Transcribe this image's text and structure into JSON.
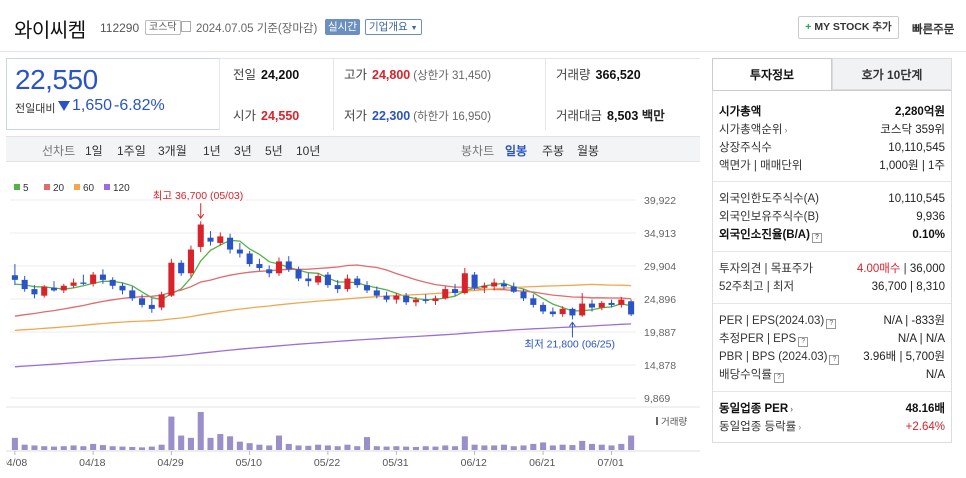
{
  "header": {
    "name": "와이씨켐",
    "code": "112290",
    "market": "코스닥",
    "date_text": "2024.07.05  기준(장마감)",
    "realtime": "실시간",
    "overview": "기업개요",
    "my_stock": "MY STOCK 추가",
    "quick_order": "빠른주문"
  },
  "price": {
    "current": "22,550",
    "change_label": "전일대비",
    "change": "1,650",
    "change_pct": "-6.82%"
  },
  "stats": {
    "prev_close_label": "전일",
    "prev_close": "24,200",
    "high_label": "고가",
    "high": "24,800",
    "upper_limit": "(상한가 31,450)",
    "volume_label": "거래량",
    "volume": "366,520",
    "open_label": "시가",
    "open": "24,550",
    "low_label": "저가",
    "low": "22,300",
    "lower_limit": "(하한가 16,950)",
    "amount_label": "거래대금",
    "amount": "8,503",
    "amount_unit": "백만"
  },
  "period_bar": {
    "line_chart": "선차트",
    "periods": [
      "1일",
      "1주일",
      "3개월",
      "1년",
      "3년",
      "5년",
      "10년"
    ],
    "candle_chart": "봉차트",
    "candles": [
      "일봉",
      "주봉",
      "월봉"
    ],
    "active_candle": "일봉"
  },
  "colors": {
    "up": "#d9232a",
    "down": "#2a54c6",
    "ma5": "#55b24a",
    "ma20": "#e06b6b",
    "ma60": "#f0a850",
    "ma120": "#9b6fd6",
    "volume": "#9b8fc9"
  },
  "chart_data": {
    "type": "candlestick",
    "legend": [
      "5",
      "20",
      "60",
      "120"
    ],
    "y_ticks": [
      "39,922",
      "34,913",
      "29,904",
      "24,896",
      "19,887",
      "14,878",
      "9,869"
    ],
    "ylim": [
      9869,
      39922
    ],
    "x_ticks": [
      "04/08",
      "04/18",
      "04/29",
      "05/10",
      "05/22",
      "05/31",
      "06/12",
      "06/21",
      "07/01"
    ],
    "x_tick_index": [
      0,
      8,
      16,
      24,
      32,
      39,
      47,
      54,
      61
    ],
    "max_label": "최고 36,700 (05/03)",
    "max_index": 19,
    "max_value": 36700,
    "min_label": "최저 21,800 (06/25)",
    "min_index": 57,
    "min_value": 21800,
    "volume_label": "거래량",
    "candles": [
      [
        28500,
        30200,
        27000,
        27800
      ],
      [
        27800,
        28400,
        26000,
        26400
      ],
      [
        26400,
        27000,
        25000,
        25600
      ],
      [
        25400,
        27000,
        25100,
        26800
      ],
      [
        26600,
        27600,
        26000,
        26200
      ],
      [
        26200,
        27200,
        25800,
        26900
      ],
      [
        26900,
        28000,
        26600,
        27400
      ],
      [
        27400,
        28600,
        27000,
        27200
      ],
      [
        27200,
        29000,
        26800,
        28600
      ],
      [
        28600,
        29400,
        27200,
        27800
      ],
      [
        27800,
        28200,
        26400,
        26900
      ],
      [
        26900,
        27400,
        25600,
        26200
      ],
      [
        26200,
        26800,
        24600,
        25000
      ],
      [
        25000,
        25600,
        23600,
        24000
      ],
      [
        24000,
        25000,
        22800,
        23400
      ],
      [
        23600,
        26000,
        23200,
        25600
      ],
      [
        25400,
        31000,
        25200,
        30400
      ],
      [
        30400,
        30800,
        28400,
        28800
      ],
      [
        28800,
        33000,
        28200,
        32400
      ],
      [
        32800,
        36700,
        32000,
        36200
      ],
      [
        34200,
        35200,
        33000,
        33600
      ],
      [
        33400,
        35000,
        33000,
        34400
      ],
      [
        34200,
        34800,
        31800,
        32400
      ],
      [
        32400,
        33400,
        31200,
        31800
      ],
      [
        31800,
        32200,
        29800,
        30200
      ],
      [
        30200,
        31000,
        29200,
        29600
      ],
      [
        29400,
        30000,
        28200,
        28800
      ],
      [
        28800,
        31200,
        28400,
        30600
      ],
      [
        30600,
        31400,
        29000,
        29400
      ],
      [
        29400,
        29800,
        27600,
        28000
      ],
      [
        28000,
        28800,
        26800,
        27600
      ],
      [
        27400,
        28800,
        27000,
        28400
      ],
      [
        28600,
        29000,
        26600,
        27000
      ],
      [
        27000,
        27800,
        25800,
        26400
      ],
      [
        26400,
        28600,
        26000,
        28000
      ],
      [
        28000,
        28400,
        26600,
        27000
      ],
      [
        27000,
        27600,
        25800,
        26200
      ],
      [
        26200,
        26800,
        25000,
        25400
      ],
      [
        25400,
        26000,
        24400,
        24800
      ],
      [
        24800,
        25800,
        24200,
        25400
      ],
      [
        25400,
        25800,
        24000,
        24400
      ],
      [
        24400,
        25200,
        23800,
        24800
      ],
      [
        24800,
        25600,
        24200,
        24600
      ],
      [
        24600,
        25400,
        24000,
        25000
      ],
      [
        25000,
        26800,
        24800,
        26400
      ],
      [
        26400,
        27200,
        25400,
        25800
      ],
      [
        25800,
        29600,
        25600,
        28800
      ],
      [
        28600,
        29000,
        26200,
        26600
      ],
      [
        26600,
        27400,
        25800,
        26900
      ],
      [
        26800,
        28000,
        26200,
        27400
      ],
      [
        27200,
        27800,
        26400,
        26800
      ],
      [
        26800,
        27400,
        25800,
        26000
      ],
      [
        26000,
        26400,
        24600,
        25000
      ],
      [
        25000,
        25600,
        23600,
        24000
      ],
      [
        24000,
        24400,
        22600,
        23000
      ],
      [
        23000,
        23600,
        22200,
        22600
      ],
      [
        22600,
        23800,
        22200,
        23400
      ],
      [
        23400,
        23600,
        21800,
        22400
      ],
      [
        22400,
        25800,
        22200,
        24200
      ],
      [
        24200,
        24800,
        23000,
        23600
      ],
      [
        23600,
        24600,
        23200,
        24300
      ],
      [
        24300,
        24800,
        23600,
        24000
      ],
      [
        24000,
        25200,
        23600,
        24800
      ],
      [
        24550,
        24800,
        22300,
        22550
      ]
    ],
    "volumes": [
      32,
      14,
      12,
      10,
      9,
      10,
      12,
      10,
      16,
      13,
      10,
      9,
      8,
      7,
      9,
      14,
      88,
      38,
      32,
      100,
      32,
      42,
      36,
      22,
      18,
      14,
      12,
      38,
      16,
      12,
      11,
      14,
      12,
      10,
      14,
      10,
      34,
      10,
      9,
      10,
      9,
      8,
      10,
      9,
      12,
      10,
      36,
      14,
      12,
      12,
      14,
      10,
      12,
      16,
      20,
      12,
      14,
      13,
      24,
      16,
      14,
      12,
      16,
      38
    ]
  },
  "right_panel": {
    "tab_active": "투자정보",
    "tab_other": "호가 10단계",
    "market_cap_label": "시가총액",
    "market_cap": "2,280억원",
    "market_cap_rank_label": "시가총액순위",
    "market_cap_rank": "코스닥 359위",
    "shares_label": "상장주식수",
    "shares": "10,110,545",
    "par_label": "액면가 | 매매단위",
    "par": "1,000원 | 1주",
    "foreign_limit_label": "외국인한도주식수(A)",
    "foreign_limit": "10,110,545",
    "foreign_hold_label": "외국인보유주식수(B)",
    "foreign_hold": "9,936",
    "foreign_ratio_label": "외국인소진율(B/A)",
    "foreign_ratio": "0.10%",
    "opinion_label": "투자의견 | 목표주가",
    "opinion": "4.00매수",
    "target": "36,000",
    "week52_label": "52주최고 | 최저",
    "week52": "36,700 | 8,310",
    "per_label": "PER | EPS(2024.03)",
    "per": "N/A | -833원",
    "est_per_label": "추정PER | EPS",
    "est_per": "N/A | N/A",
    "pbr_label": "PBR | BPS (2024.03)",
    "pbr": "3.96배 | 5,700원",
    "dividend_label": "배당수익률",
    "dividend": "N/A",
    "industry_per_label": "동일업종 PER",
    "industry_per": "48.16배",
    "industry_chg_label": "동일업종 등락률",
    "industry_chg": "+2.64%"
  }
}
